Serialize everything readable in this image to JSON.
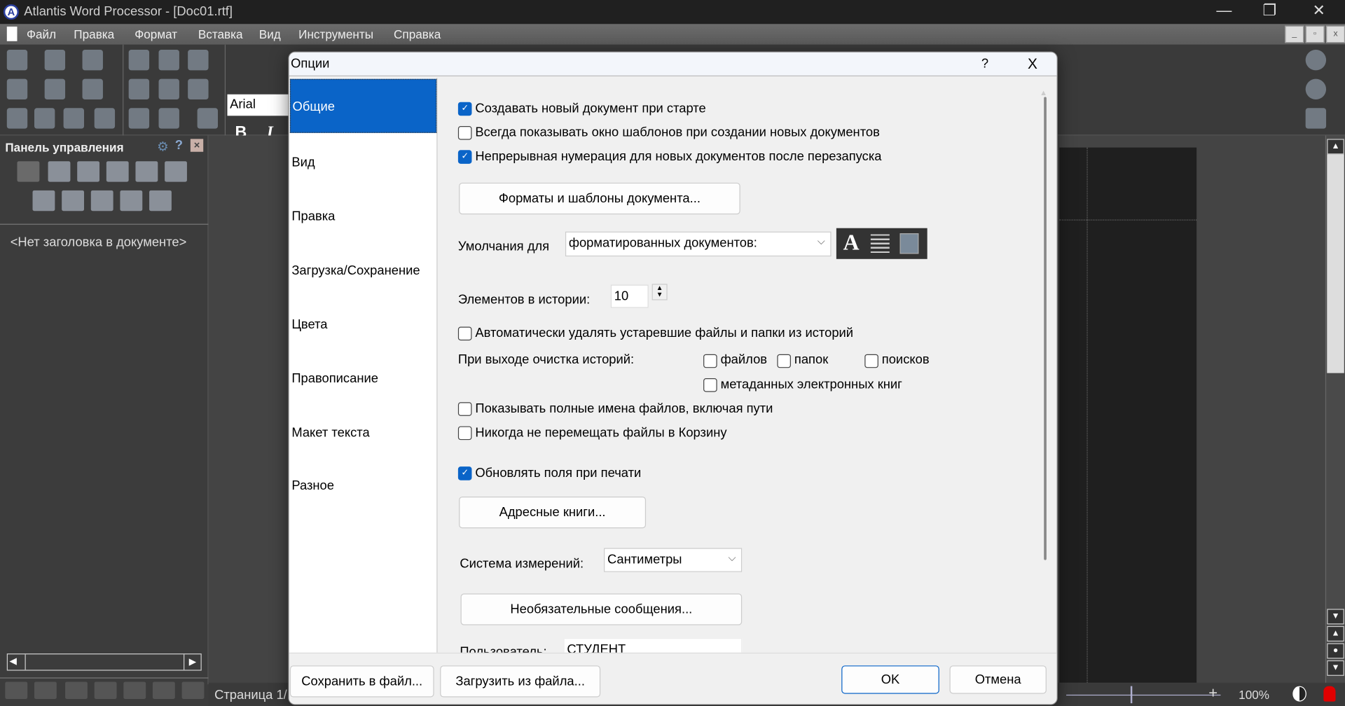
{
  "window": {
    "title": "Atlantis Word Processor - [Doc01.rtf]",
    "minimize": "—",
    "restore": "❐",
    "close": "✕"
  },
  "menu": {
    "items": [
      "Файл",
      "Правка",
      "Формат",
      "Вставка",
      "Вид",
      "Инструменты",
      "Справка"
    ]
  },
  "toolbar": {
    "font": "Arial",
    "bold": "B",
    "italic": "I"
  },
  "left_panel": {
    "title": "Панель управления",
    "no_heading": "<Нет заголовка в документе>"
  },
  "statusbar": {
    "page": "Страница 1/",
    "zoom": "100%"
  },
  "dialog": {
    "title": "Опции",
    "help": "?",
    "close": "X",
    "nav": [
      {
        "label": "Общие",
        "selected": true
      },
      {
        "label": "Вид"
      },
      {
        "label": "Правка"
      },
      {
        "label": "Загрузка/Сохранение"
      },
      {
        "label": "Цвета"
      },
      {
        "label": "Правописание"
      },
      {
        "label": "Макет текста"
      },
      {
        "label": "Разное"
      }
    ],
    "options": {
      "create_new": {
        "label": "Создавать новый документ при старте",
        "checked": true
      },
      "show_templates": {
        "label": "Всегда показывать окно шаблонов при создании новых документов",
        "checked": false
      },
      "continuous_numbering": {
        "label": "Непрерывная нумерация для новых документов после перезапуска",
        "checked": true
      },
      "formats_button": "Форматы и шаблоны документа...",
      "defaults_label": "Умолчания для",
      "defaults_value": "форматированных документов:",
      "history_label": "Элементов в истории:",
      "history_value": "10",
      "auto_delete": {
        "label": "Автоматически удалять устаревшие файлы и папки из историй",
        "checked": false
      },
      "clear_label": "При выходе очистка историй:",
      "clear_files": {
        "label": "файлов",
        "checked": false
      },
      "clear_folders": {
        "label": "папок",
        "checked": false
      },
      "clear_searches": {
        "label": "поисков",
        "checked": false
      },
      "clear_metadata": {
        "label": "метаданных электронных книг",
        "checked": false
      },
      "full_paths": {
        "label": "Показывать полные имена файлов, включая пути",
        "checked": false
      },
      "no_recycle": {
        "label": "Никогда не перемещать файлы в Корзину",
        "checked": false
      },
      "update_fields": {
        "label": "Обновлять поля при печати",
        "checked": true
      },
      "address_books": "Адресные книги...",
      "units_label": "Система измерений:",
      "units_value": "Сантиметры",
      "optional_messages": "Необязательные сообщения...",
      "user_label": "Пользователь:",
      "user_value": "СТУДЕНТ"
    },
    "footer": {
      "save": "Сохранить в файл...",
      "load": "Загрузить из файла...",
      "ok": "OK",
      "cancel": "Отмена"
    }
  }
}
